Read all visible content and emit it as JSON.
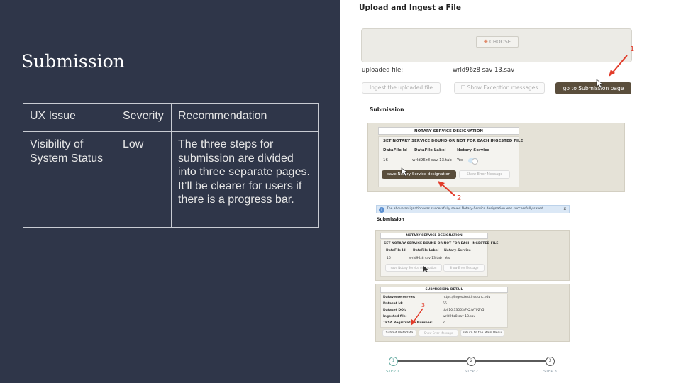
{
  "slide": {
    "title": "Submission",
    "table": {
      "headers": [
        "UX Issue",
        "Severity",
        "Recommendation"
      ],
      "rows": [
        [
          "Visibility of System Status",
          "Low",
          "The three steps for submission are divided into three separate pages. It’ll be clearer for users if there is a progress bar."
        ]
      ]
    }
  },
  "screenshot": {
    "title": "Upload and Ingest a File",
    "choose_label": "CHOOSE",
    "uploaded_file_label": "uploaded file:",
    "uploaded_file_name": "wrld96z8 sav 13.sav",
    "ingest_button": "Ingest the uploaded file",
    "show_exception_button": "Show Exception messages",
    "go_submission_button": "go to Submission page",
    "submission_heading": "Submission",
    "notary": {
      "header": "NOTARY SERVICE DESIGNATION",
      "subheader": "SET NOTARY SERVICE BOUND OR NOT FOR EACH INGESTED FILE",
      "columns": [
        "DataFile Id",
        "DataFile Label",
        "Notary-Service"
      ],
      "row": [
        "16",
        "wrld96z8 sav 13.tab",
        "Yes"
      ],
      "save_button": "save Notary Service designation",
      "show_error": "Show Error Message"
    },
    "alert_text": "The above assignation was successfully saved Notary-Service designation was successfully saved.",
    "alert_close": "x",
    "detail": {
      "header": "SUBMISSION: DETAIL",
      "rows": [
        [
          "Dataverse server:",
          "https://ingesttest.irss.unc.edu"
        ],
        [
          "Dataset Id:",
          "56"
        ],
        [
          "Dataset DOI:",
          "doi:10.33563/FK2/VYPZY5"
        ],
        [
          "Ingested file:",
          "wrld96z8 sav 13.sav"
        ],
        [
          "TRSA Registration Number:",
          "2"
        ]
      ],
      "submit_button": "Submit Metadata",
      "show_error": "Show Error Message",
      "return_button": "return to the Main Menu"
    },
    "annotations": [
      "1",
      "2",
      "3"
    ],
    "steps": [
      {
        "num": "1",
        "label": "STEP 1"
      },
      {
        "num": "2",
        "label": "STEP 2"
      },
      {
        "num": "3",
        "label": "STEP 3"
      }
    ],
    "step_progress": 0.0
  }
}
